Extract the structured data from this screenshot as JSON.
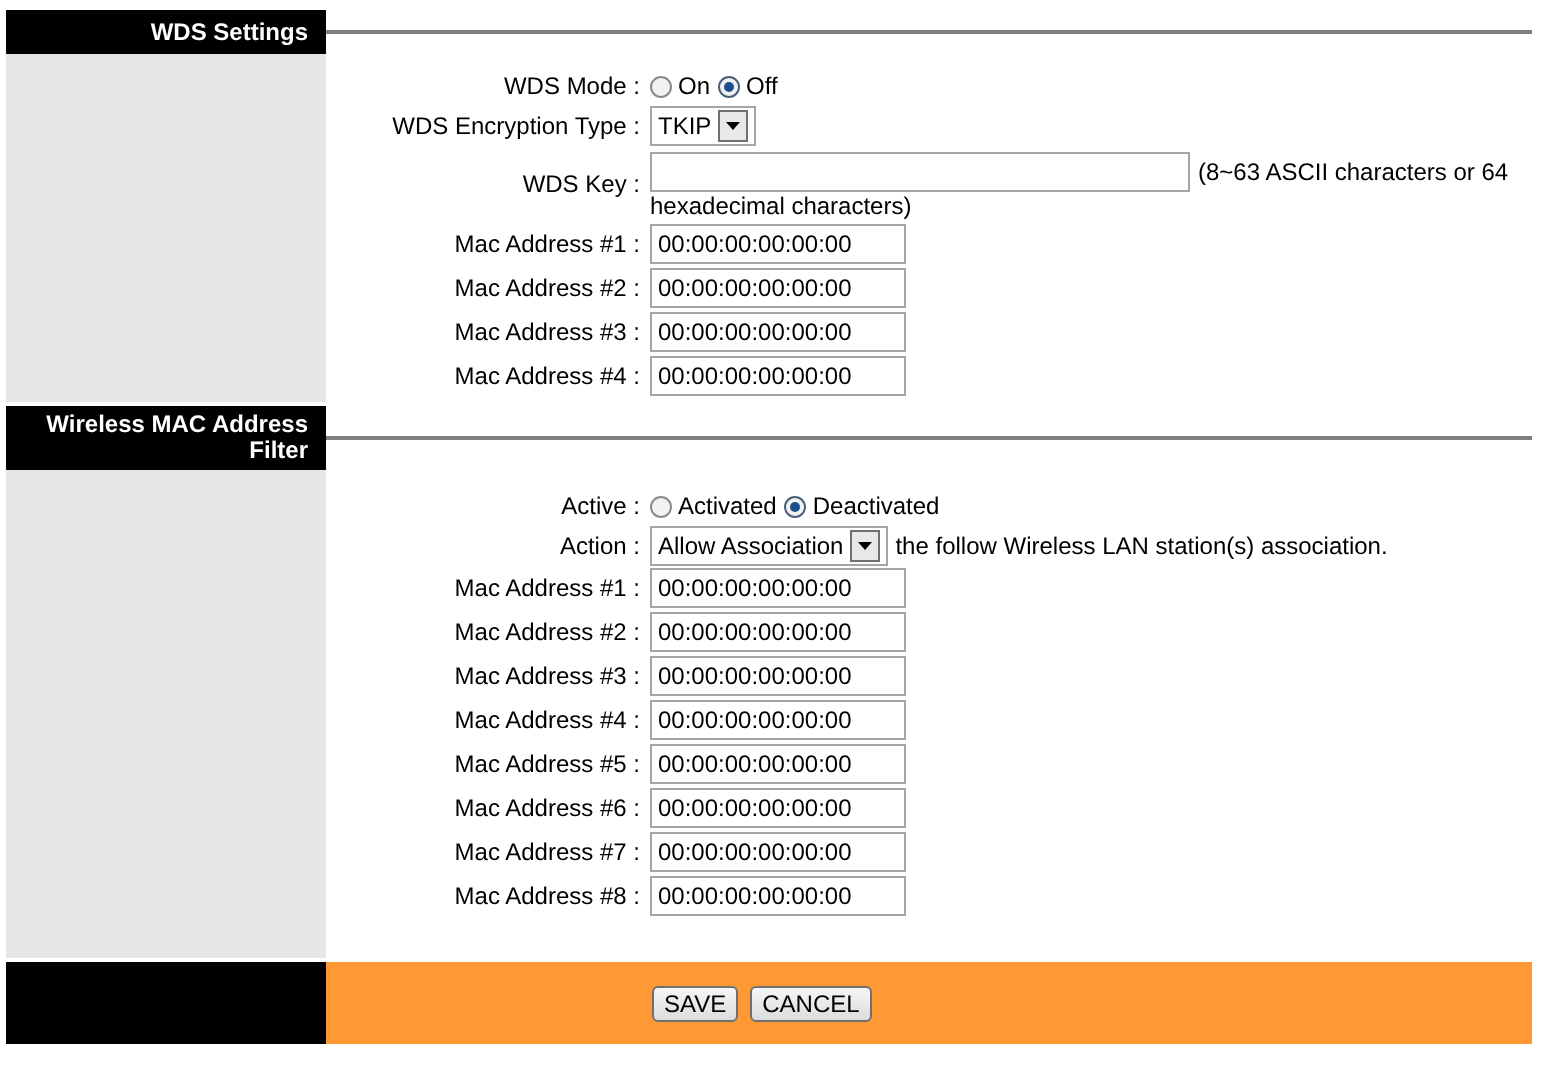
{
  "wds": {
    "title": "WDS Settings",
    "mode": {
      "label": "WDS Mode :",
      "options": [
        {
          "label": "On",
          "selected": false
        },
        {
          "label": "Off",
          "selected": true
        }
      ]
    },
    "encryption": {
      "label": "WDS Encryption Type :",
      "value": "TKIP"
    },
    "key": {
      "label": "WDS Key :",
      "hint_lines": [
        "(8~63 ASCII characters or 64",
        "hexadecimal characters)"
      ]
    },
    "mac_addresses": [
      {
        "label": "Mac Address #1 :",
        "value": "00:00:00:00:00:00"
      },
      {
        "label": "Mac Address #2 :",
        "value": "00:00:00:00:00:00"
      },
      {
        "label": "Mac Address #3 :",
        "value": "00:00:00:00:00:00"
      },
      {
        "label": "Mac Address #4 :",
        "value": "00:00:00:00:00:00"
      }
    ]
  },
  "mac_filter": {
    "title": "Wireless MAC Address Filter",
    "active": {
      "label": "Active :",
      "options": [
        {
          "label": "Activated",
          "selected": false
        },
        {
          "label": "Deactivated",
          "selected": true
        }
      ]
    },
    "action": {
      "label": "Action :",
      "value": "Allow Association",
      "note": "the follow Wireless LAN station(s) association."
    },
    "mac_addresses": [
      {
        "label": "Mac Address #1 :",
        "value": "00:00:00:00:00:00"
      },
      {
        "label": "Mac Address #2 :",
        "value": "00:00:00:00:00:00"
      },
      {
        "label": "Mac Address #3 :",
        "value": "00:00:00:00:00:00"
      },
      {
        "label": "Mac Address #4 :",
        "value": "00:00:00:00:00:00"
      },
      {
        "label": "Mac Address #5 :",
        "value": "00:00:00:00:00:00"
      },
      {
        "label": "Mac Address #6 :",
        "value": "00:00:00:00:00:00"
      },
      {
        "label": "Mac Address #7 :",
        "value": "00:00:00:00:00:00"
      },
      {
        "label": "Mac Address #8 :",
        "value": "00:00:00:00:00:00"
      }
    ]
  },
  "buttons": [
    {
      "label": "SAVE"
    },
    {
      "label": "CANCEL"
    }
  ]
}
